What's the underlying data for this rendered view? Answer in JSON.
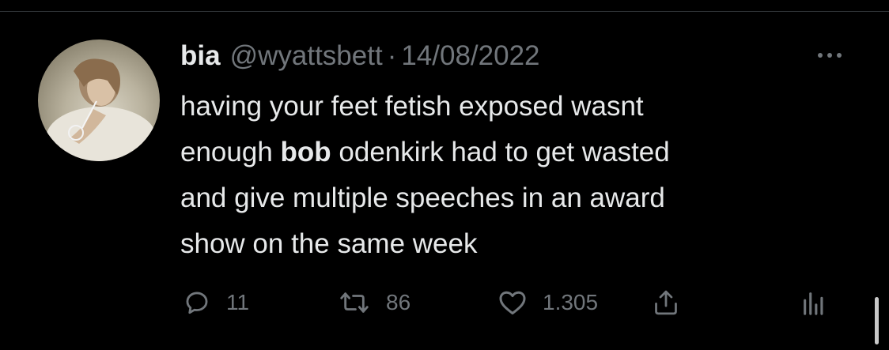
{
  "tweet": {
    "author": {
      "display_name": "bia",
      "handle": "@wyattsbett",
      "avatar_icon": "avatar-photo"
    },
    "separator": "·",
    "date": "14/08/2022",
    "text_parts": [
      "having your feet fetish exposed wasnt",
      "enough ",
      "bob",
      " odenkirk had to get wasted",
      "and give multiple speeches in an award",
      "show on the same week"
    ]
  },
  "actions": {
    "reply": {
      "icon": "reply-icon",
      "count": "11"
    },
    "retweet": {
      "icon": "retweet-icon",
      "count": "86"
    },
    "like": {
      "icon": "heart-icon",
      "count": "1.305"
    },
    "share": {
      "icon": "share-icon"
    },
    "analytics": {
      "icon": "analytics-icon"
    }
  },
  "colors": {
    "background": "#000000",
    "primary_text": "#e7e9ea",
    "secondary_text": "#71767b"
  }
}
